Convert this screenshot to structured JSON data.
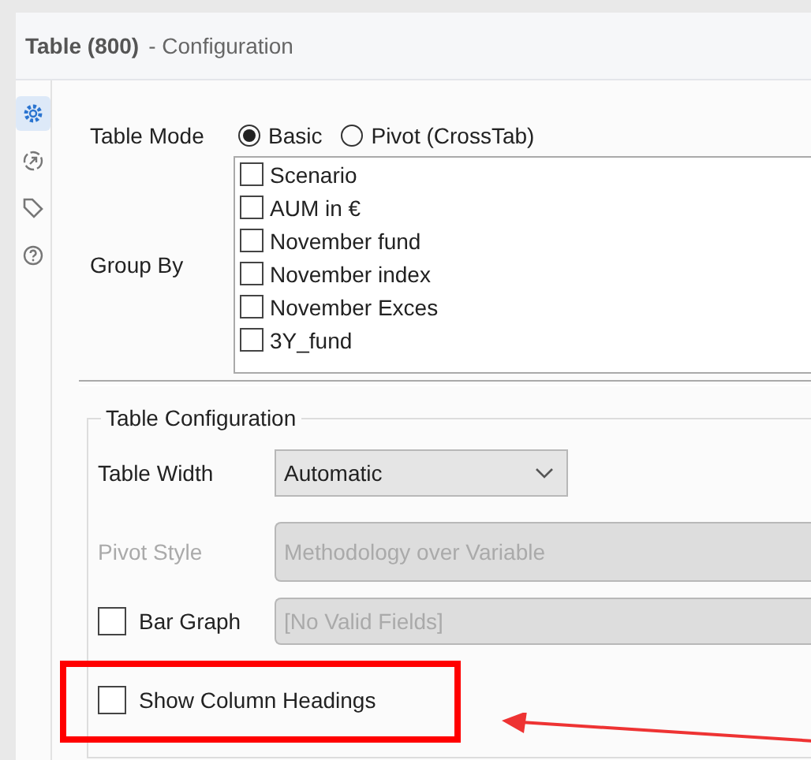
{
  "window": {
    "title": "Table (800)",
    "subtitle": "- Configuration"
  },
  "side_tabs": [
    {
      "kind": "gear",
      "selected": true
    },
    {
      "kind": "arrow",
      "selected": false
    },
    {
      "kind": "tag",
      "selected": false
    },
    {
      "kind": "help",
      "selected": false
    }
  ],
  "table_mode": {
    "label": "Table Mode",
    "options": [
      {
        "label": "Basic",
        "selected": true
      },
      {
        "label": "Pivot (CrossTab)",
        "selected": false
      }
    ]
  },
  "group_by": {
    "label": "Group By",
    "items": [
      {
        "label": "Scenario",
        "checked": false
      },
      {
        "label": "AUM in €",
        "checked": false
      },
      {
        "label": "November fund",
        "checked": false
      },
      {
        "label": "November index",
        "checked": false
      },
      {
        "label": "November Exces",
        "checked": false
      },
      {
        "label": "3Y_fund",
        "checked": false
      }
    ]
  },
  "table_configuration": {
    "title": "Table Configuration",
    "table_width": {
      "label": "Table Width",
      "value": "Automatic"
    },
    "pivot_style": {
      "label": "Pivot Style",
      "value": "Methodology over Variable",
      "disabled": true
    },
    "bar_graph": {
      "label": "Bar Graph",
      "checked": false,
      "value": "[No Valid Fields]",
      "disabled": true
    },
    "show_column_headings": {
      "label": "Show Column Headings",
      "checked": false,
      "highlighted": true
    }
  }
}
